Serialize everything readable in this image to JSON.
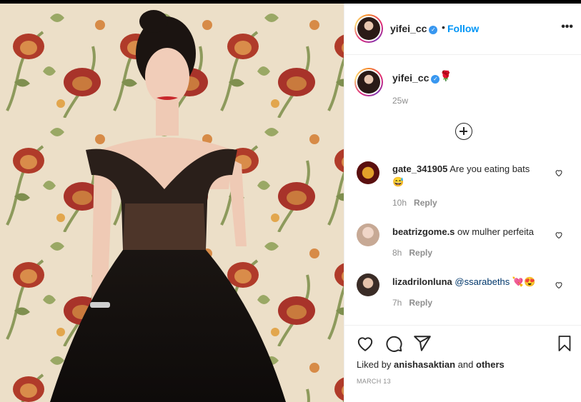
{
  "post": {
    "username": "yifei_cc",
    "follow_label": "Follow",
    "separator": "•",
    "more_label": "•••",
    "caption_emoji": "🌹",
    "caption_age": "25w"
  },
  "comments": [
    {
      "username": "gate_341905",
      "text": "Are you eating bats",
      "emoji": "😅",
      "age": "10h",
      "reply": "Reply",
      "avatar_color": "#5a0f0f"
    },
    {
      "username": "beatrizgome.s",
      "text": "ow mulher perfeita",
      "age": "8h",
      "reply": "Reply",
      "avatar_color": "#d9c2b6"
    },
    {
      "username": "lizadrilonluna",
      "text": "@ssarabeths",
      "emoji": "💘😍",
      "age": "7h",
      "reply": "Reply",
      "avatar_color": "#5b4a40"
    }
  ],
  "footer": {
    "liked_by_prefix": "Liked by",
    "liked_by_user": "anishasaktian",
    "and": "and",
    "others": "others",
    "date": "MARCH 13"
  },
  "icons": {
    "like": "heart-icon",
    "comment": "comment-icon",
    "share": "share-icon",
    "save": "bookmark-icon",
    "add": "plus-circle-icon",
    "verified": "verified-badge-icon"
  },
  "colors": {
    "link_blue": "#0095f6",
    "verified_blue": "#3897f0",
    "muted": "#8e8e8e"
  }
}
